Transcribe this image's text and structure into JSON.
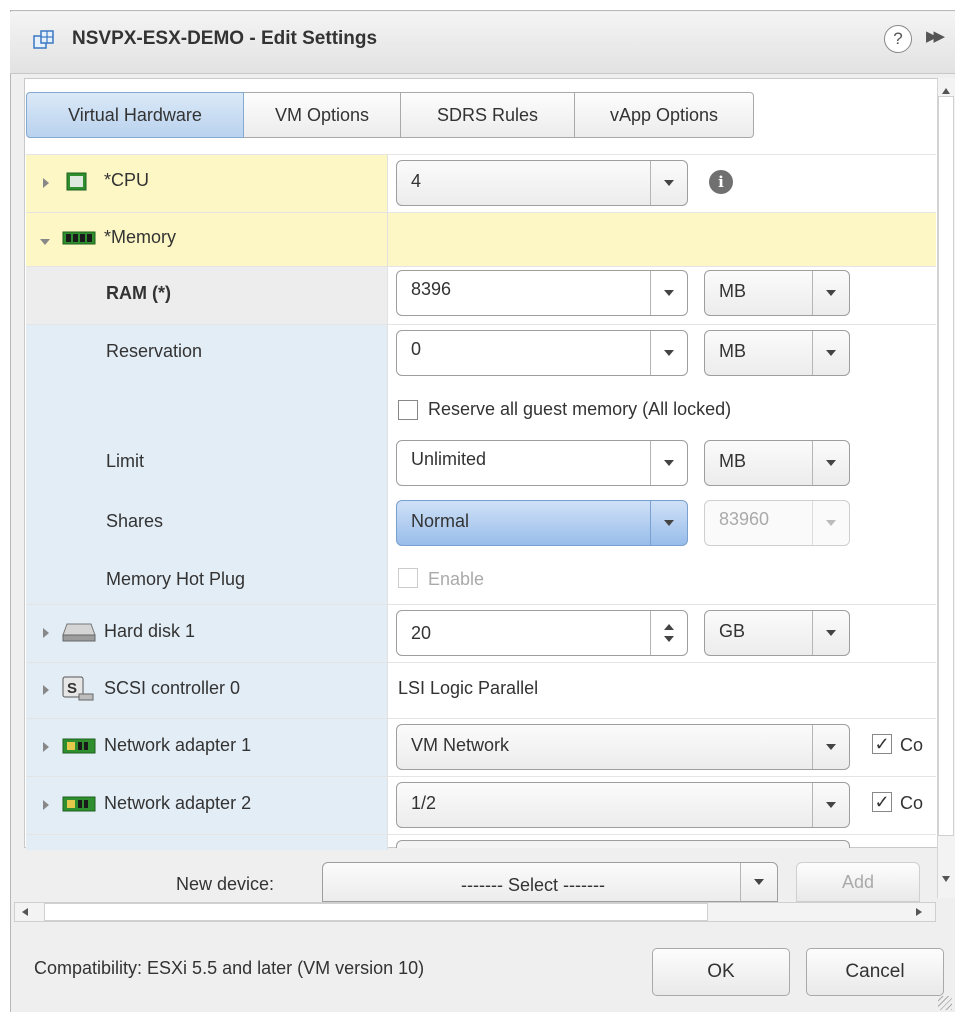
{
  "window": {
    "title": "NSVPX-ESX-DEMO - Edit Settings",
    "help_glyph": "?",
    "forward_glyph": "▶▶"
  },
  "tabs": [
    {
      "label": "Virtual Hardware",
      "active": true
    },
    {
      "label": "VM Options",
      "active": false
    },
    {
      "label": "SDRS Rules",
      "active": false
    },
    {
      "label": "vApp Options",
      "active": false
    }
  ],
  "hardware": {
    "cpu": {
      "label": "*CPU",
      "value": "4",
      "icon": "cpu-chip-icon"
    },
    "memory": {
      "label": "*Memory",
      "icon": "memory-module-icon",
      "ram": {
        "label": "RAM (*)",
        "value": "8396",
        "unit": "MB"
      },
      "reservation": {
        "label": "Reservation",
        "value": "0",
        "unit": "MB"
      },
      "reserve_all": {
        "label": "Reserve all guest memory (All locked)",
        "checked": false
      },
      "limit": {
        "label": "Limit",
        "value": "Unlimited",
        "unit": "MB"
      },
      "shares": {
        "label": "Shares",
        "value": "Normal",
        "number": "83960"
      },
      "hot_plug": {
        "label": "Memory Hot Plug",
        "option": "Enable",
        "checked": false
      }
    },
    "hard_disk": {
      "label": "Hard disk 1",
      "value": "20",
      "unit": "GB",
      "icon": "hard-disk-icon"
    },
    "scsi": {
      "label": "SCSI controller 0",
      "value": "LSI Logic Parallel",
      "icon": "scsi-controller-icon"
    },
    "net1": {
      "label": "Network adapter 1",
      "value": "VM Network",
      "connect": "Co",
      "checked": true,
      "icon": "network-adapter-icon"
    },
    "net2": {
      "label": "Network adapter 2",
      "value": "1/2",
      "connect": "Co",
      "checked": true,
      "icon": "network-adapter-icon"
    }
  },
  "new_device": {
    "label": "New device:",
    "select": "------- Select -------",
    "add": "Add"
  },
  "footer": {
    "compatibility": "Compatibility: ESXi 5.5 and later (VM version 10)",
    "ok": "OK",
    "cancel": "Cancel"
  },
  "colors": {
    "highlight_row": "#fdf7c5",
    "left_column": "#e3edf6",
    "active_tab": "#c6dbf1",
    "selected_combo": "#a9c9ee",
    "nic_green": "#2f8f2f"
  }
}
